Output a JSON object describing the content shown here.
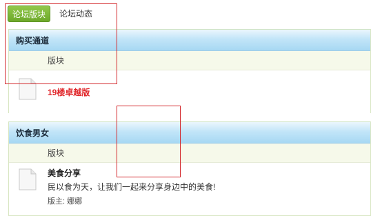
{
  "tabs": [
    {
      "label": "论坛版块",
      "active": true
    },
    {
      "label": "论坛动态",
      "active": false
    }
  ],
  "sections": [
    {
      "title": "购买通道",
      "column_label": "版块",
      "forums": [
        {
          "name": "19楼卓越版"
        }
      ]
    },
    {
      "title": "饮食男女",
      "column_label": "版块",
      "forums": [
        {
          "name": "美食分享",
          "description": "民以食为天，让我们一起来分享身边中的美食!",
          "moderator": "版主: 娜娜"
        }
      ]
    }
  ],
  "colors": {
    "tab_active": "#7cb635",
    "header_blue": "#b7dff5",
    "highlight_red": "#e0262a",
    "annotation_red": "#d3272b"
  }
}
